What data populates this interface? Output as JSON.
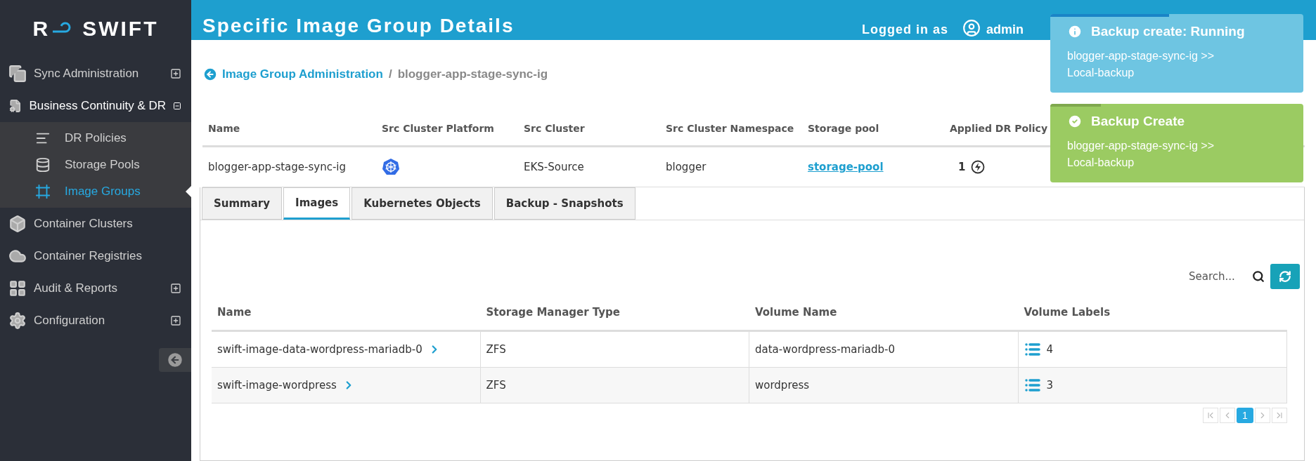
{
  "sidebar": {
    "logo": {
      "mark": "R",
      "name": "SWIFT"
    },
    "items": [
      {
        "kind": "group",
        "label": "Sync Administration",
        "expanded": false
      },
      {
        "kind": "group",
        "label": "Business Continuity & DR",
        "expanded": true,
        "children": [
          {
            "label": "DR Policies",
            "selected": false
          },
          {
            "label": "Storage Pools",
            "selected": false
          },
          {
            "label": "Image Groups",
            "selected": true
          }
        ]
      },
      {
        "kind": "link",
        "label": "Container Clusters"
      },
      {
        "kind": "link",
        "label": "Container Registries"
      },
      {
        "kind": "group",
        "label": "Audit & Reports",
        "expanded": false
      },
      {
        "kind": "group",
        "label": "Configuration",
        "expanded": false
      }
    ]
  },
  "header": {
    "title": "Specific Image Group Details",
    "logged_in_label": "Logged in as",
    "user": "admin"
  },
  "breadcrumb": {
    "parent": "Image Group Administration",
    "separator": "/",
    "current": "blogger-app-stage-sync-ig"
  },
  "group_table": {
    "columns": [
      "Name",
      "Src Cluster Platform",
      "Src Cluster",
      "Src Cluster Namespace",
      "Storage pool",
      "Applied DR Policy"
    ],
    "rows": [
      {
        "name": "blogger-app-stage-sync-ig",
        "src_cluster": "EKS-Source",
        "namespace": "blogger",
        "storage_pool": "storage-pool",
        "dr_policies": "1"
      }
    ]
  },
  "tabs": [
    {
      "label": "Summary",
      "selected": false
    },
    {
      "label": "Images",
      "selected": true
    },
    {
      "label": "Kubernetes Objects",
      "selected": false
    },
    {
      "label": "Backup - Snapshots",
      "selected": false
    }
  ],
  "images": {
    "search": {
      "placeholder": "Search..."
    },
    "columns": [
      "Name",
      "Storage Manager Type",
      "Volume Name",
      "Volume Labels"
    ],
    "rows": [
      {
        "name": "swift-image-data-wordpress-mariadb-0",
        "storage_manager_type": "ZFS",
        "volume_name": "data-wordpress-mariadb-0",
        "volume_labels": "4"
      },
      {
        "name": "swift-image-wordpress",
        "storage_manager_type": "ZFS",
        "volume_name": "wordpress",
        "volume_labels": "3"
      }
    ],
    "pages": [
      {
        "label": "1",
        "selected": true
      }
    ]
  },
  "toasts": [
    {
      "kind": "info",
      "title": "Backup create: Running",
      "message": "blogger-app-stage-sync-ig >> Local-backup",
      "level": 0.47
    },
    {
      "kind": "success",
      "title": "Backup Create",
      "message": "blogger-app-stage-sync-ig >> Local-backup",
      "level": 0.2
    }
  ]
}
